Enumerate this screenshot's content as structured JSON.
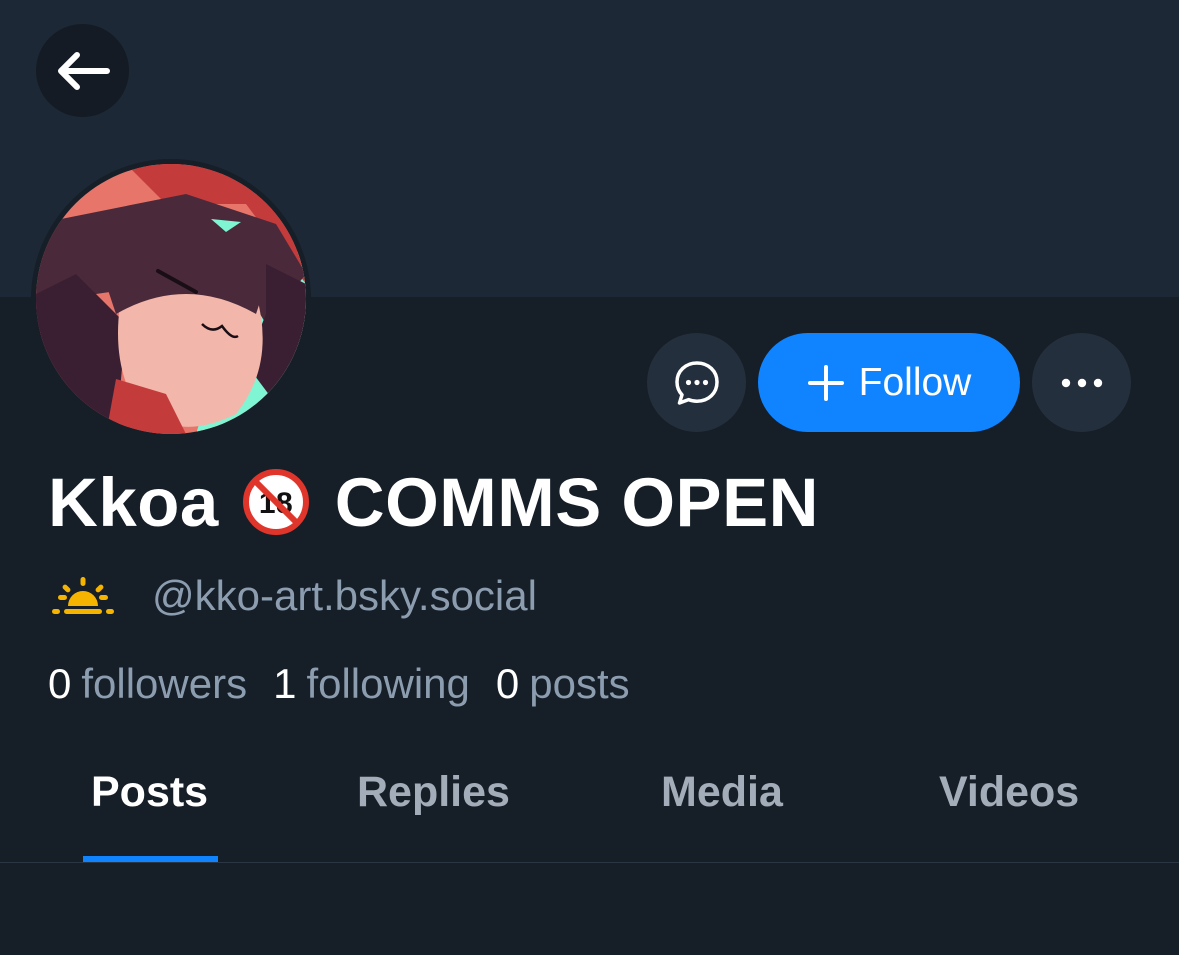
{
  "profile": {
    "display_name": "Kkoa",
    "age_badge": "🔞",
    "name_suffix": "COMMS OPEN",
    "status_emoji": "🌅",
    "handle": "@kko-art.bsky.social"
  },
  "actions": {
    "follow_label": "Follow"
  },
  "stats": {
    "followers": {
      "count": "0",
      "label": "followers"
    },
    "following": {
      "count": "1",
      "label": "following"
    },
    "posts": {
      "count": "0",
      "label": "posts"
    }
  },
  "tabs": [
    {
      "label": "Posts",
      "active": true
    },
    {
      "label": "Replies",
      "active": false
    },
    {
      "label": "Media",
      "active": false
    },
    {
      "label": "Videos",
      "active": false
    }
  ],
  "icons": {
    "back": "arrow-left-icon",
    "message": "chat-bubble-icon",
    "follow": "plus-icon",
    "more": "ellipsis-icon"
  },
  "colors": {
    "background": "#161e27",
    "banner": "#1c2836",
    "accent": "#1083fe",
    "secondary_text": "#8c9db0"
  }
}
